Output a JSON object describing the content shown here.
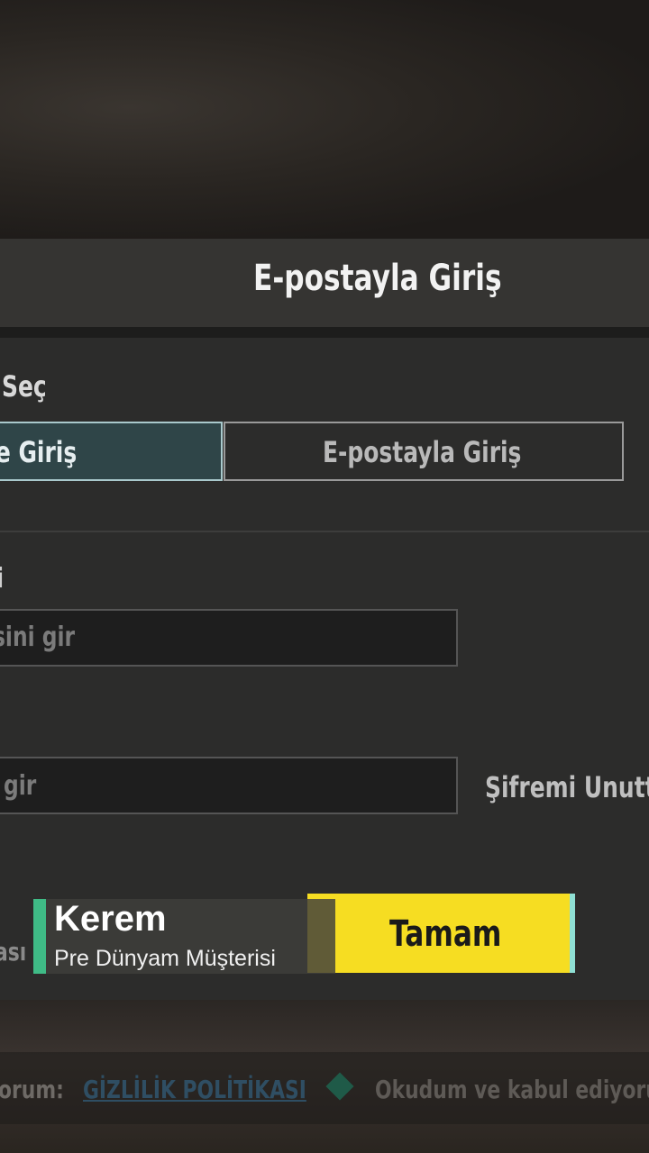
{
  "dialog": {
    "title": "E-postayla Giriş",
    "section_label": "Seç",
    "tabs": [
      {
        "label": "yle Giriş",
        "active": true
      },
      {
        "label": "E-postayla Giriş",
        "active": false
      }
    ],
    "email_field": {
      "label": "i",
      "placeholder": "sini gir"
    },
    "password_field": {
      "placeholder": "gir"
    },
    "forgot_password": "Şifremi Unutt",
    "left_cut_text": "ası",
    "confirm_button": "Tamam"
  },
  "footer": {
    "prefix": "orum:",
    "privacy_link": "GİZLİLİK POLİTİKASI",
    "accept_text": "Okudum ve kabul ediyoru"
  },
  "overlay": {
    "name": "Kerem",
    "subtitle": "Pre Dünyam Müşterisi",
    "accent_color": "#3fbb86"
  },
  "colors": {
    "button_yellow": "#f6dd22",
    "tab_active_border": "#a9c9cc"
  }
}
